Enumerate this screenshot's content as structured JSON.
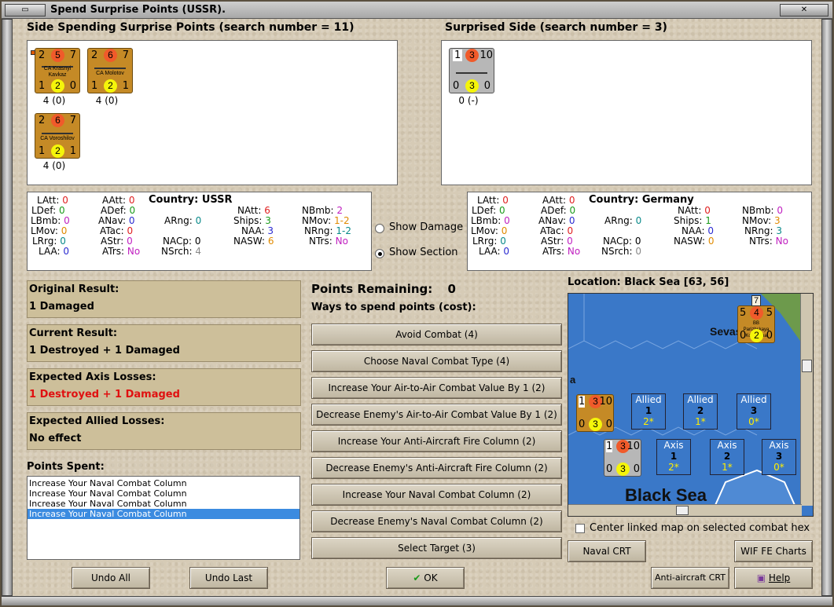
{
  "window": {
    "title": "Spend Surprise Points (USSR)."
  },
  "left_side": {
    "title": "Side Spending Surprise Points (search number = 11)",
    "units": [
      {
        "name": "CA Krasnyi Kavkaz",
        "tl": "2",
        "tc": "5",
        "tr": "7",
        "bl": "1",
        "bc": "2",
        "br": "0",
        "caption": "4 (0)"
      },
      {
        "name": "CA Molotov",
        "tl": "2",
        "tc": "6",
        "tr": "7",
        "bl": "1",
        "bc": "2",
        "br": "1",
        "caption": "4 (0)"
      },
      {
        "name": "CA Voroshilov",
        "tl": "2",
        "tc": "6",
        "tr": "7",
        "bl": "1",
        "bc": "2",
        "br": "1",
        "caption": "4 (0)"
      }
    ]
  },
  "right_side": {
    "title": "Surprised Side (search number = 3)",
    "units": [
      {
        "name": "",
        "tl": "1",
        "tc": "3",
        "tr": "10",
        "bl": "0",
        "bc": "3",
        "br": "0",
        "caption": "0 (-)"
      }
    ]
  },
  "ussr_stats": {
    "country_label": "Country:",
    "country": "USSR",
    "LAtt": "0",
    "LDef": "0",
    "LBmb": "0",
    "LMov": "0",
    "LRrg": "0",
    "LAA": "0",
    "AAtt": "0",
    "ADef": "0",
    "ANav": "0",
    "ATac": "0",
    "AStr": "0",
    "ATrs": "No",
    "ARng": "0",
    "NACp": "0",
    "NSrch": "4",
    "NAtt": "6",
    "Ships": "3",
    "NAA": "3",
    "NASW": "6",
    "NBmb": "2",
    "NMov": "1-2",
    "NRng": "1-2",
    "NTrs": "No"
  },
  "ger_stats": {
    "country_label": "Country:",
    "country": "Germany",
    "LAtt": "0",
    "LDef": "0",
    "LBmb": "0",
    "LMov": "0",
    "LRrg": "0",
    "LAA": "0",
    "AAtt": "0",
    "ADef": "0",
    "ANav": "0",
    "ATac": "0",
    "AStr": "0",
    "ATrs": "No",
    "ARng": "0",
    "NACp": "0",
    "NSrch": "0",
    "NAtt": "0",
    "Ships": "1",
    "NAA": "0",
    "NASW": "0",
    "NBmb": "0",
    "NMov": "3",
    "NRng": "3",
    "NTrs": "No"
  },
  "options": {
    "show_damage": "Show Damage",
    "show_section": "Show Section",
    "selected": "Show Section"
  },
  "results": {
    "original_label": "Original Result:",
    "original": "1 Damaged",
    "current_label": "Current Result:",
    "current": "1 Destroyed + 1 Damaged",
    "axis_label": "Expected Axis Losses:",
    "axis": "1 Destroyed + 1 Damaged",
    "allied_label": "Expected Allied Losses:",
    "allied": "No effect"
  },
  "points_spent": {
    "label": "Points Spent:",
    "items": [
      "Increase Your Naval Combat Column",
      "Increase Your Naval Combat Column",
      "Increase Your Naval Combat Column",
      "Increase Your Naval Combat Column"
    ]
  },
  "points_remaining": {
    "label": "Points Remaining:",
    "value": "0"
  },
  "ways": {
    "label": "Ways to spend points (cost):",
    "buttons": [
      "Avoid Combat (4)",
      "Choose Naval Combat Type (4)",
      "Increase Your Air-to-Air Combat Value By 1 (2)",
      "Decrease Enemy's Air-to-Air Combat Value By 1 (2)",
      "Increase Your Anti-Aircraft Fire Column (2)",
      "Decrease Enemy's Anti-Aircraft Fire Column (2)",
      "Increase Your Naval Combat Column (2)",
      "Decrease Enemy's Naval Combat Column (2)",
      "Select Target (3)"
    ]
  },
  "map": {
    "location": "Location: Black Sea [63, 56]",
    "sea_label": "Black Sea",
    "city_label": "Sevas",
    "edge_letter": "a",
    "bb_name": "BB Parizhskaya Kommuna",
    "bb_vals": {
      "tl": "5",
      "tc": "4",
      "tr": "5",
      "bl": "0",
      "bc": "2",
      "br": "0",
      "top": "7"
    },
    "allied": [
      {
        "side": "Allied",
        "num": "1",
        "val": "2*"
      },
      {
        "side": "Allied",
        "num": "2",
        "val": "1*"
      },
      {
        "side": "Allied",
        "num": "3",
        "val": "0*"
      }
    ],
    "axis": [
      {
        "side": "Axis",
        "num": "1",
        "val": "2*"
      },
      {
        "side": "Axis",
        "num": "2",
        "val": "1*"
      },
      {
        "side": "Axis",
        "num": "3",
        "val": "0*"
      }
    ],
    "center_linked": "Center linked map on selected combat hex"
  },
  "buttons": {
    "undo_all": "Undo All",
    "undo_last": "Undo Last",
    "ok": "OK",
    "naval_crt": "Naval CRT",
    "wif_fe_charts": "WIF FE Charts",
    "aa_crt": "Anti-aircraft CRT",
    "help": "Help"
  }
}
